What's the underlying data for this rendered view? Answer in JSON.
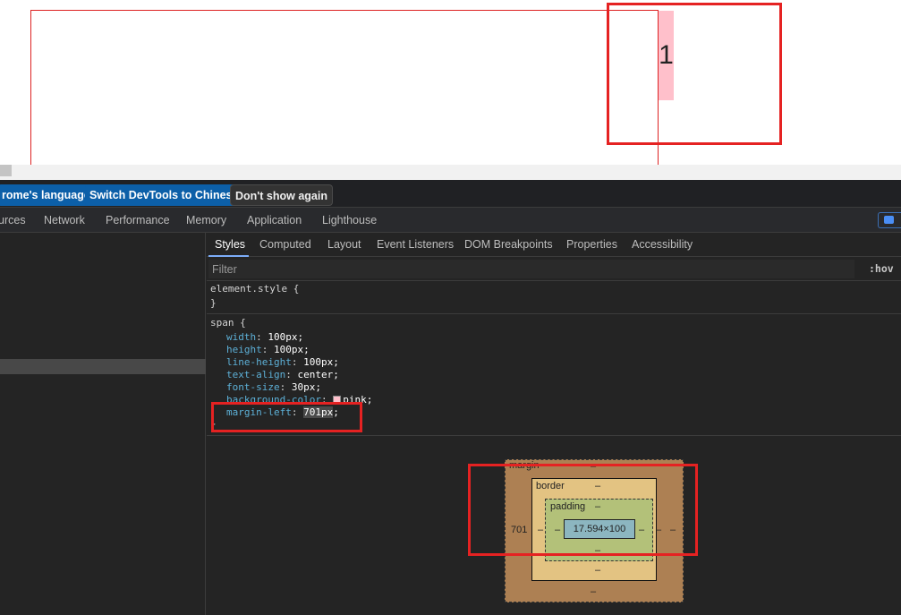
{
  "page": {
    "span_text": "1"
  },
  "language_bar": {
    "match_button": "rome's language",
    "switch_button": "Switch DevTools to Chinese",
    "dismiss_button": "Don't show again"
  },
  "main_tabs": [
    "urces",
    "Network",
    "Performance",
    "Memory",
    "Application",
    "Lighthouse"
  ],
  "sub_tabs": [
    "Styles",
    "Computed",
    "Layout",
    "Event Listeners",
    "DOM Breakpoints",
    "Properties",
    "Accessibility"
  ],
  "filter": {
    "placeholder": "Filter",
    "hov": ":hov"
  },
  "element_style": {
    "selector": "element.style {",
    "close": "}"
  },
  "span_rule": {
    "selector": "span {",
    "declarations": [
      {
        "prop": "width",
        "value": "100px;"
      },
      {
        "prop": "height",
        "value": "100px;"
      },
      {
        "prop": "line-height",
        "value": "100px;"
      },
      {
        "prop": "text-align",
        "value": "center;"
      },
      {
        "prop": "font-size",
        "value": "30px;"
      },
      {
        "prop": "background-color",
        "value": "pink;"
      },
      {
        "prop": "margin-left",
        "value": "701px",
        "suffix": ";"
      }
    ],
    "close": "}"
  },
  "box_model": {
    "margin_label": "margin",
    "margin_top": "–",
    "margin_left": "701",
    "margin_right": "–",
    "margin_bottom": "–",
    "border_label": "border",
    "border_top": "–",
    "border_left": "–",
    "border_right": "–",
    "border_bottom": "–",
    "padding_label": "padding",
    "padding_top": "–",
    "padding_left": "–",
    "padding_right": "–",
    "padding_bottom": "–",
    "content": "17.594×100"
  },
  "colors": {
    "annotation": "#e52222",
    "span_background": "pink",
    "devtools_background": "#242424",
    "button_blue": "#0c5fa8"
  }
}
